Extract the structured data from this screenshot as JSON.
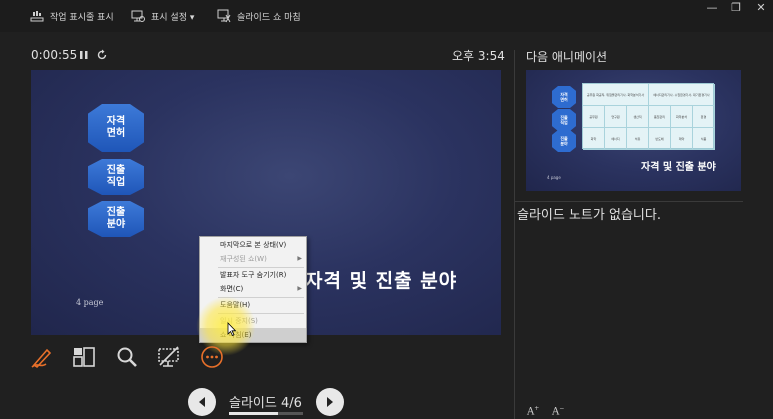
{
  "toolbar": {
    "taskbar_label": "작업 표시줄 표시",
    "display_settings_label": "표시 설정 ▾",
    "end_show_label": "슬라이드 쇼 마침"
  },
  "window": {
    "minimize": "—",
    "restore": "❐",
    "close": "✕"
  },
  "presenter": {
    "elapsed_time": "0:00:55",
    "clock": "오후 3:54",
    "slide_counter": "슬라이드 4/6",
    "slide_progress": 0.667
  },
  "current_slide": {
    "hexagons": [
      "자격\n면허",
      "진출\n직업",
      "진출\n분야"
    ],
    "title": "자격 및 진출 분야",
    "page_label": "4 page"
  },
  "context_menu": {
    "items": [
      {
        "label": "마지막으로 본 상태(V)",
        "disabled": false,
        "submenu": false
      },
      {
        "label": "재구성된 쇼(W)",
        "disabled": true,
        "submenu": true
      },
      {
        "label": "발표자 도구 숨기기(R)",
        "disabled": false,
        "submenu": false
      },
      {
        "label": "화면(C)",
        "disabled": false,
        "submenu": true
      },
      {
        "label": "도움말(H)",
        "disabled": false,
        "submenu": false
      },
      {
        "label": "일시 중지(S)",
        "disabled": true,
        "submenu": false
      },
      {
        "label": "쇼 마침(E)",
        "disabled": false,
        "submenu": false
      }
    ]
  },
  "tools": [
    "pen-icon",
    "slide-grid-icon",
    "zoom-icon",
    "screen-toggle-icon",
    "more-options-icon"
  ],
  "next_panel": {
    "label": "다음 애니메이션",
    "preview": {
      "hexagons": [
        "자격\n면허",
        "진출\n직업",
        "진출\n분야"
      ],
      "title": "자격 및 진출 분야",
      "page_label": "4 page",
      "table_rows": [
        [
          "공무원 화공직, 위험물관리기사, 화학분석기사",
          "에너지관리기사, 수질환경기사, 대기환경기사"
        ],
        [
          "공무원",
          "연구원",
          "생산직",
          "품질관리",
          "화학분석",
          "환경"
        ],
        [
          "화학",
          "에너지",
          "석유",
          "반도체",
          "제약",
          "식품"
        ]
      ]
    }
  },
  "notes": {
    "text": "슬라이드 노트가 없습니다."
  },
  "font_controls": {
    "increase": "A",
    "decrease": "A"
  },
  "colors": {
    "accent": "#e8702a",
    "slide_bg": "#2b3360",
    "hex_fill": "#2a66cc"
  }
}
